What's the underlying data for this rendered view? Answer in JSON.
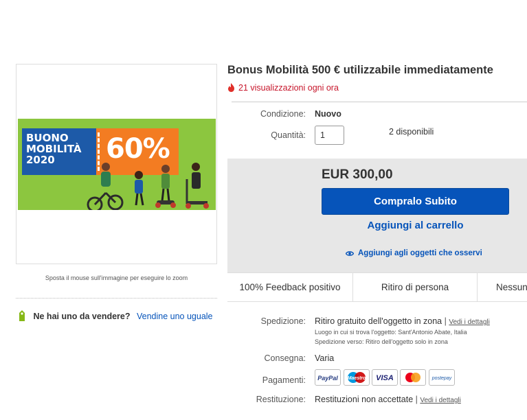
{
  "listing": {
    "title": "Bonus Mobilità 500 € utilizzabile immediatamente",
    "views": "21 visualizzazioni ogni ora"
  },
  "image": {
    "ticket_line1": "BUONO",
    "ticket_line2": "MOBILITÀ",
    "ticket_line3": "2020",
    "ticket_percent": "60%",
    "zoom_hint": "Sposta il mouse sull'immagine per eseguire lo zoom"
  },
  "seller": {
    "question": "Ne hai uno da vendere?",
    "link": "Vendine uno uguale"
  },
  "details": {
    "condition_label": "Condizione:",
    "condition_value": "Nuovo",
    "quantity_label": "Quantità:",
    "quantity_value": "1",
    "available": "2 disponibili"
  },
  "buy": {
    "price": "EUR 300,00",
    "buy_now": "Compralo Subito",
    "add_to_cart": "Aggiungi al carrello",
    "watch": "Aggiungi agli oggetti che osservi"
  },
  "features": [
    "100% Feedback positivo",
    "Ritiro di persona",
    "Nessun"
  ],
  "shipping": {
    "label": "Spedizione:",
    "value": "Ritiro gratuito dell'oggetto in zona",
    "details_link": "Vedi i dettagli",
    "location": "Luogo in cui si trova l'oggetto:  Sant'Antonio Abate, Italia",
    "destination": "Spedizione verso:  Ritiro dell'oggetto solo in zona"
  },
  "delivery": {
    "label": "Consegna:",
    "value": "Varia"
  },
  "payments": {
    "label": "Pagamenti:",
    "methods": [
      "PayPal",
      "Maestro",
      "VISA",
      "Mastercard",
      "postepay"
    ]
  },
  "returns": {
    "label": "Restituzione:",
    "value": "Restituzioni non accettate",
    "details_link": "Vedi i dettagli"
  },
  "colors": {
    "accent_blue": "#0654ba",
    "alert_red": "#c7162b",
    "promo_green": "#8cc63f",
    "promo_orange": "#f37c22"
  }
}
